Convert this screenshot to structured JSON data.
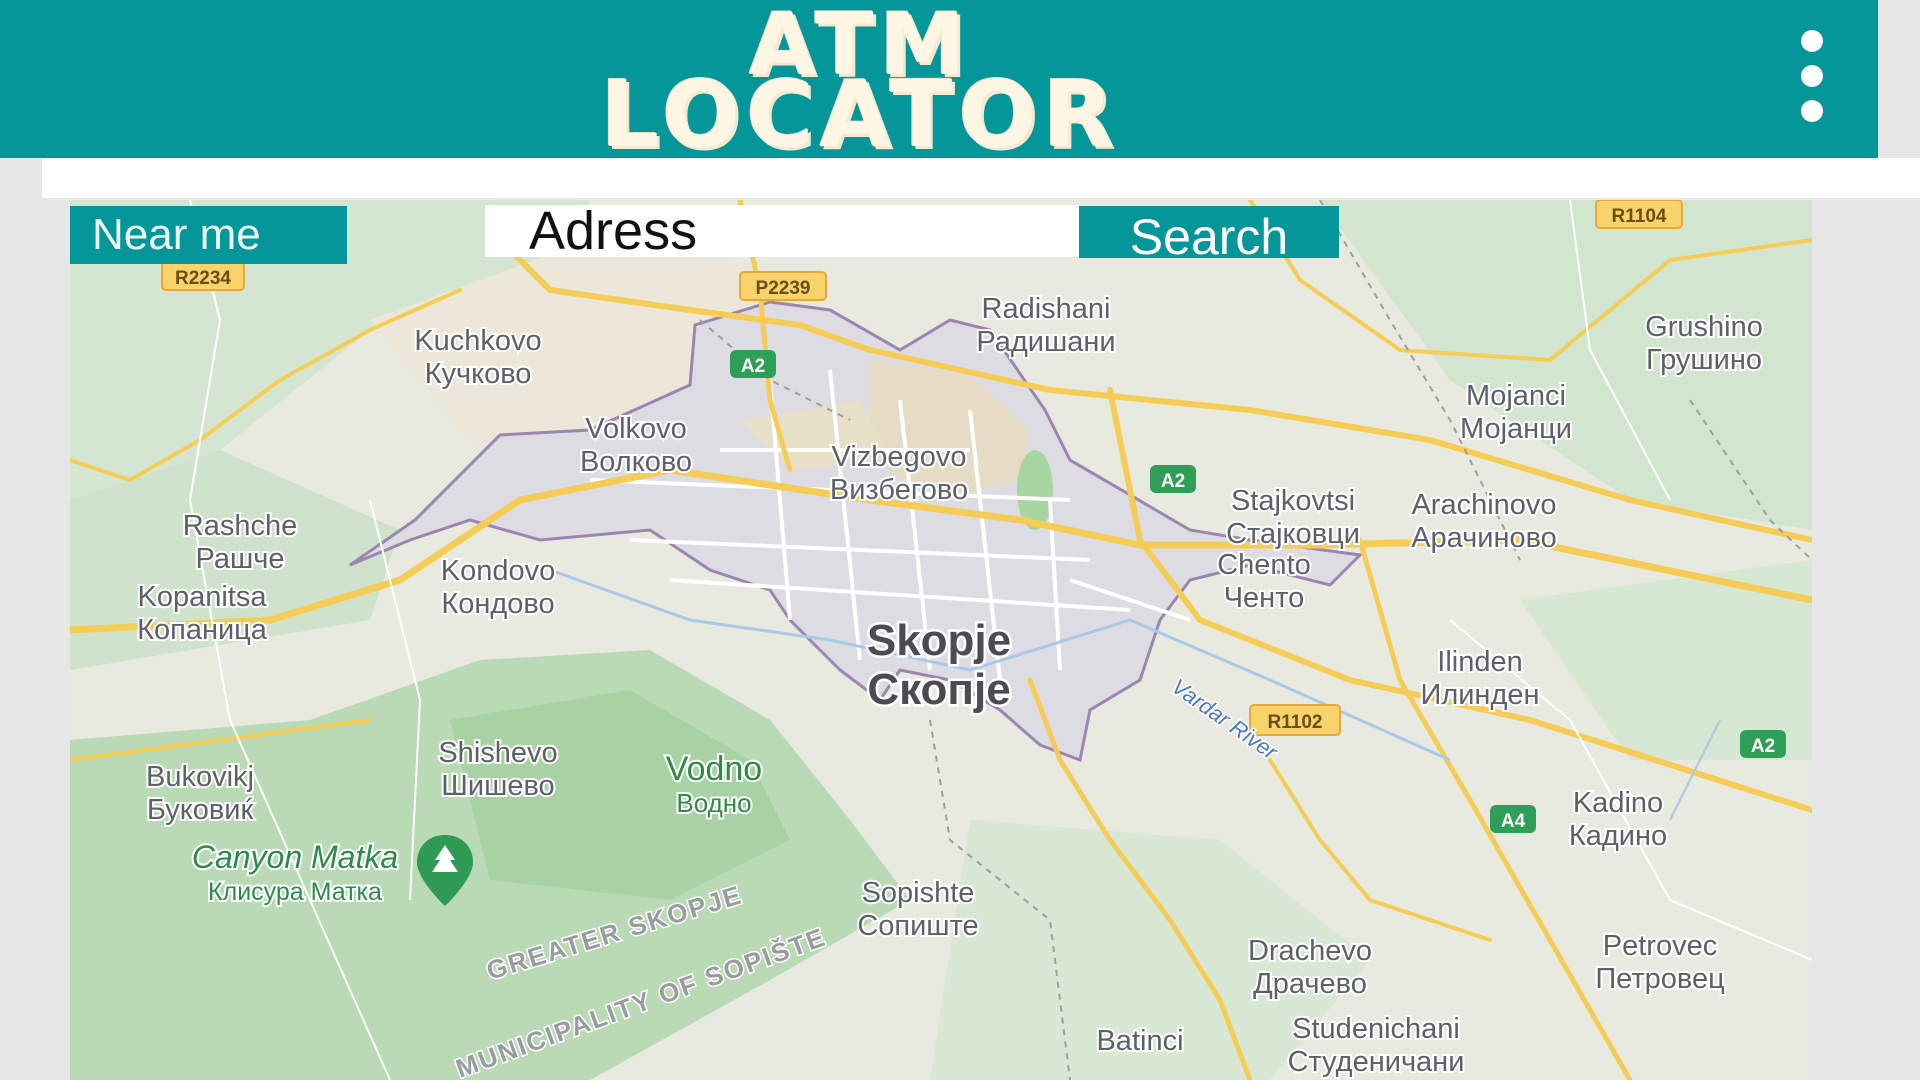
{
  "header": {
    "title_line1": "ATM",
    "title_line2": "LOCATOR",
    "menu_icon": "kebab-menu-icon"
  },
  "controls": {
    "near_me_label": "Near me",
    "address_placeholder": "Adress",
    "search_label": "Search"
  },
  "map": {
    "road_badges": [
      "R2234",
      "P2239",
      "A2",
      "A2",
      "R1102",
      "A2",
      "A4",
      "R1104"
    ],
    "city": {
      "latin": "Skopje",
      "cyrillic": "Скопје"
    },
    "places": [
      {
        "latin": "Kuchkovo",
        "cyrillic": "Кучково"
      },
      {
        "latin": "Radishani",
        "cyrillic": "Радишани"
      },
      {
        "latin": "Grushino",
        "cyrillic": "Грушино"
      },
      {
        "latin": "Volkovo",
        "cyrillic": "Волково"
      },
      {
        "latin": "Vizbegovo",
        "cyrillic": "Визбегово"
      },
      {
        "latin": "Mojanci",
        "cyrillic": "Мојанци"
      },
      {
        "latin": "Rashche",
        "cyrillic": "Рашче"
      },
      {
        "latin": "Stajkovtsi",
        "cyrillic": "Стајковци"
      },
      {
        "latin": "Arachinovo",
        "cyrillic": "Арачиново"
      },
      {
        "latin": "Kondovo",
        "cyrillic": "Кондово"
      },
      {
        "latin": "Chento",
        "cyrillic": "Ченто"
      },
      {
        "latin": "Kopanitsa",
        "cyrillic": "Копаница"
      },
      {
        "latin": "Ilinden",
        "cyrillic": "Илинден"
      },
      {
        "latin": "Shishevo",
        "cyrillic": "Шишево"
      },
      {
        "latin": "Bukovikj",
        "cyrillic": "Буковиќ"
      },
      {
        "latin": "Kadino",
        "cyrillic": "Кадино"
      },
      {
        "latin": "Sopishte",
        "cyrillic": "Сопиште"
      },
      {
        "latin": "Drachevo",
        "cyrillic": "Драчево"
      },
      {
        "latin": "Petrovec",
        "cyrillic": "Петровец"
      },
      {
        "latin": "Studenichani",
        "cyrillic": "Студеничани"
      },
      {
        "latin": "Batinci",
        "cyrillic": ""
      }
    ],
    "vodno": {
      "latin": "Vodno",
      "cyrillic": "Водно"
    },
    "canyon": {
      "latin": "Canyon Matka",
      "cyrillic": "Клисура Матка",
      "icon": "tree-pin-icon"
    },
    "river": "Vardar River",
    "region_labels": [
      "GREATER SKOPJE",
      "MUNICIPALITY OF SOPIŠTE"
    ]
  }
}
